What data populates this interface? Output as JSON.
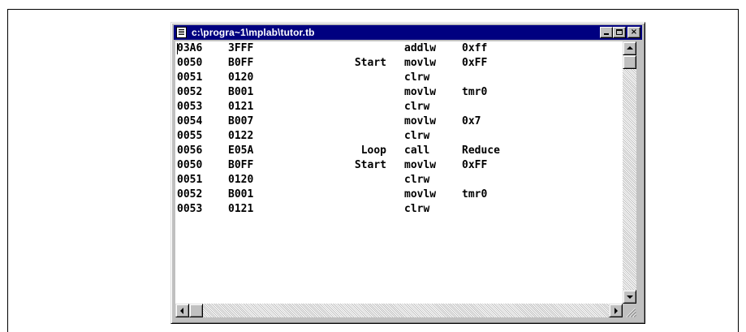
{
  "window": {
    "title": "c:\\progra~1\\mplab\\tutor.tb",
    "buttons": {
      "minimize": "minimize-button",
      "maximize": "maximize-button",
      "close": "×"
    }
  },
  "code_lines": [
    {
      "addr": "03A6",
      "op": "3FFF",
      "label": "",
      "mnemonic": "addlw",
      "arg": "0xff"
    },
    {
      "addr": "0050",
      "op": "B0FF",
      "label": "Start",
      "mnemonic": "movlw",
      "arg": "0xFF"
    },
    {
      "addr": "0051",
      "op": "0120",
      "label": "",
      "mnemonic": "clrw",
      "arg": ""
    },
    {
      "addr": "0052",
      "op": "B001",
      "label": "",
      "mnemonic": "movlw",
      "arg": "tmr0"
    },
    {
      "addr": "0053",
      "op": "0121",
      "label": "",
      "mnemonic": "clrw",
      "arg": ""
    },
    {
      "addr": "0054",
      "op": "B007",
      "label": "",
      "mnemonic": "movlw",
      "arg": "0x7"
    },
    {
      "addr": "0055",
      "op": "0122",
      "label": "",
      "mnemonic": "clrw",
      "arg": ""
    },
    {
      "addr": "0056",
      "op": "E05A",
      "label": "Loop",
      "mnemonic": "call",
      "arg": "Reduce"
    },
    {
      "addr": "0050",
      "op": "B0FF",
      "label": "Start",
      "mnemonic": "movlw",
      "arg": "0xFF"
    },
    {
      "addr": "0051",
      "op": "0120",
      "label": "",
      "mnemonic": "clrw",
      "arg": ""
    },
    {
      "addr": "0052",
      "op": "B001",
      "label": "",
      "mnemonic": "movlw",
      "arg": "tmr0"
    },
    {
      "addr": "0053",
      "op": "0121",
      "label": "",
      "mnemonic": "clrw",
      "arg": ""
    }
  ],
  "scroll": {
    "vertical_position": 0,
    "horizontal_position": 0
  },
  "colors": {
    "titlebar": "#000080",
    "chrome": "#c0c0c0",
    "text": "#000000"
  }
}
